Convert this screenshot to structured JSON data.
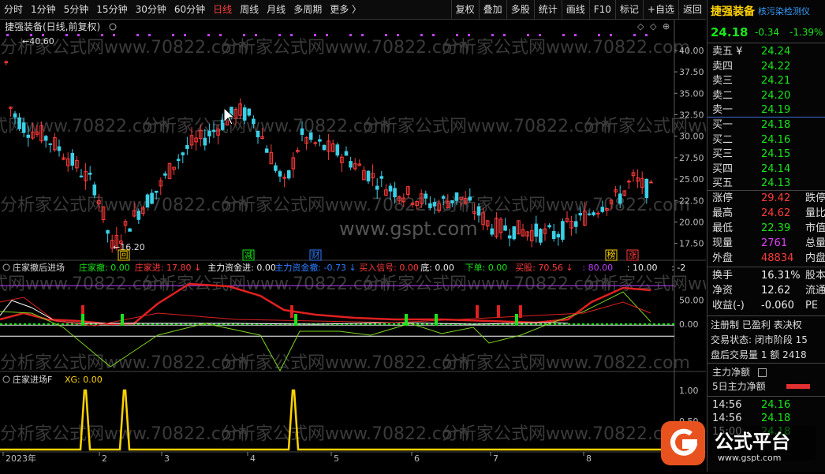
{
  "toolbar": {
    "periods": [
      "分时",
      "1分钟",
      "5分钟",
      "15分钟",
      "30分钟",
      "60分钟",
      "日线",
      "周线",
      "月线",
      "多周期",
      "更多 〉"
    ],
    "active": "日线",
    "buttons": [
      "复权",
      "叠加",
      "多股",
      "统计",
      "画线",
      "F10",
      "标记",
      "+自选",
      "返回"
    ]
  },
  "main_chart": {
    "title": "捷强装备(日线,前复权)",
    "high_label": "40.60",
    "low_label": "16.20",
    "price_axis": [
      "40.00",
      "37.50",
      "35.00",
      "32.50",
      "30.00",
      "27.50",
      "25.00",
      "22.50",
      "20.00",
      "17.50"
    ],
    "badges": [
      {
        "text": "回",
        "color": "#ffd400"
      },
      {
        "text": "减",
        "color": "#19e619"
      },
      {
        "text": "财",
        "color": "#2e7dff"
      },
      {
        "text": "榜",
        "color": "#ffd400"
      },
      {
        "text": "涨",
        "color": "#ff3b3b"
      }
    ],
    "watermarks": [
      "分析家公式网www.70822.com",
      "www.gspt.com"
    ]
  },
  "indicator1": {
    "name": "庄家撤后进场",
    "items": [
      {
        "label": "庄家撤:",
        "value": "0.00",
        "color": "#19e619"
      },
      {
        "label": "庄家进:",
        "value": "17.80",
        "color": "#ff3b3b",
        "arrow": "↓"
      },
      {
        "label": "主力资金进:",
        "value": "0.00",
        "color": "#eee"
      },
      {
        "label": "主力资金撤:",
        "value": "-0.73",
        "color": "#2e7dff",
        "arrow": "↓"
      },
      {
        "label": "买入信号:",
        "value": "0.00",
        "color": "#ff3b3b"
      },
      {
        "label": "底:",
        "value": "0.00",
        "color": "#eee"
      },
      {
        "label": "下单:",
        "value": "0.00",
        "color": "#19e619"
      },
      {
        "label": "买股:",
        "value": "70.56",
        "color": "#ff3b3b",
        "arrow": "↓"
      },
      {
        "label": ":",
        "value": "80.00",
        "color": "#c040ff"
      },
      {
        "label": ":",
        "value": "10.00",
        "color": "#eee"
      },
      {
        "label": ":",
        "value": "-2",
        "color": "#eee"
      }
    ],
    "axis": [
      "50.00",
      "0.00"
    ]
  },
  "indicator2": {
    "name": "庄家进场F",
    "label": "XG:",
    "value": "0.00",
    "axis": [
      "1.00",
      "0.50"
    ]
  },
  "time_axis": [
    "2023年",
    "2",
    "3",
    "4",
    "5",
    "6",
    "7",
    "8"
  ],
  "quote": {
    "name": "捷强装备",
    "tag": "核污染检测仪",
    "price": "24.18",
    "change": "-0.34",
    "pct": "-1.39%",
    "asks": [
      {
        "label": "卖五",
        "extra": "¥",
        "price": "24.24"
      },
      {
        "label": "卖四",
        "price": "24.22"
      },
      {
        "label": "卖三",
        "price": "24.21"
      },
      {
        "label": "卖二",
        "price": "24.20"
      },
      {
        "label": "卖一",
        "price": "24.19"
      }
    ],
    "bids": [
      {
        "label": "买一",
        "price": "24.18"
      },
      {
        "label": "买二",
        "price": "24.16"
      },
      {
        "label": "买三",
        "price": "24.15"
      },
      {
        "label": "买四",
        "price": "24.14"
      },
      {
        "label": "买五",
        "price": "24.13"
      }
    ],
    "stats": [
      {
        "label": "涨停",
        "value": "29.42",
        "color": "#ff3b3b",
        "extra": "跌停"
      },
      {
        "label": "最高",
        "value": "24.62",
        "color": "#ff3b3b",
        "extra": "量比"
      },
      {
        "label": "最低",
        "value": "22.39",
        "color": "#19e619",
        "extra": "市值"
      },
      {
        "label": "现量",
        "value": "2761",
        "color": "#e040fb",
        "extra": "总量"
      },
      {
        "label": "外盘",
        "value": "48834",
        "color": "#ff3b3b",
        "extra": "内盘"
      }
    ],
    "fin": [
      {
        "label": "换手",
        "value": "16.31%",
        "extra": "股本"
      },
      {
        "label": "净资",
        "value": "12.62",
        "extra": "流通"
      },
      {
        "label": "收益(-)",
        "value": "-0.060",
        "extra": "PE"
      }
    ],
    "info1": "注册制 已盈利 表决权",
    "info2": "交易状态: 闭市阶段 15",
    "info3": "盘后交易量 1 额 2418",
    "flow1": "主力净额",
    "flow2": "5日主力净额",
    "ticks": [
      {
        "time": "14:56",
        "price": "24.16"
      },
      {
        "time": "14:56",
        "price": "24.18"
      },
      {
        "time": "15:00",
        "price": "24.18"
      }
    ]
  },
  "logo": {
    "text": "公式平台",
    "url": "www.gspt.com"
  }
}
